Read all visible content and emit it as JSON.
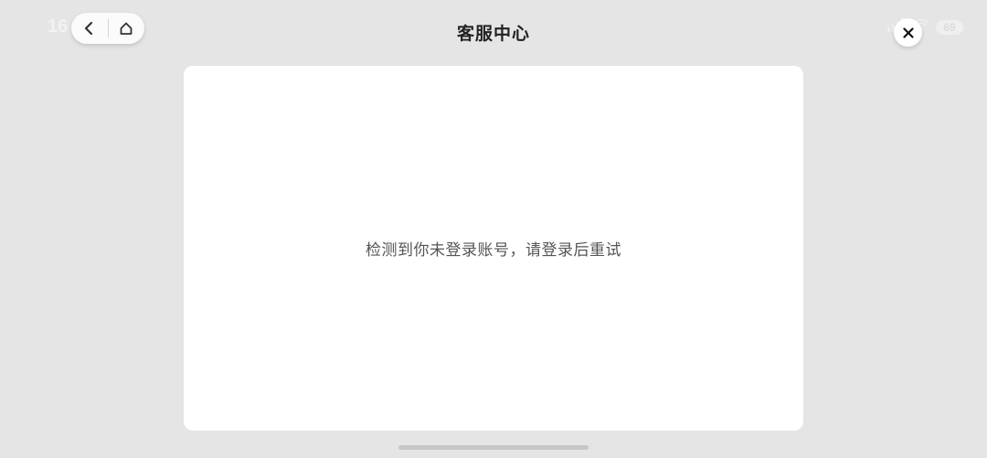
{
  "status_bar": {
    "time": "16",
    "battery": "69",
    "signal_icon": "cellular-signal-icon",
    "wifi_icon": "wifi-icon"
  },
  "nav": {
    "back_icon": "chevron-left-icon",
    "home_icon": "home-icon"
  },
  "header": {
    "title": "客服中心",
    "close_icon": "close-icon"
  },
  "main": {
    "message": "检测到你未登录账号，请登录后重试"
  },
  "colors": {
    "background": "#e5e5e5",
    "card": "#ffffff",
    "title_text": "#222222",
    "message_text": "#555555"
  }
}
